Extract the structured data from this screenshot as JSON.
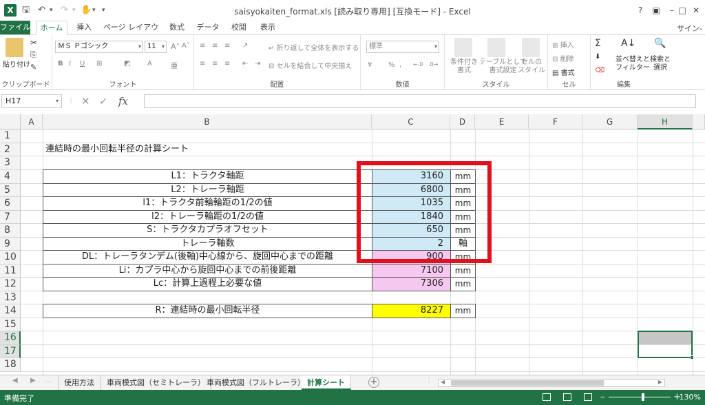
{
  "titlebar": {
    "title": "saisyokaiten_format.xls [読み取り専用] [互換モード] - Excel",
    "help": "?",
    "window_controls": [
      "restore-ribbon-icon",
      "minimize-icon",
      "maximize-icon",
      "close-icon"
    ]
  },
  "ribbon_tabs": {
    "file": "ファイル",
    "tabs": [
      "ホーム",
      "挿入",
      "ページ レイアウト",
      "数式",
      "データ",
      "校閲",
      "表示"
    ],
    "active": "ホーム",
    "signin": "サイン-"
  },
  "ribbon": {
    "clipboard": {
      "paste": "貼り付け",
      "label": "クリップボード"
    },
    "font": {
      "name": "ＭＳ Ｐゴシック",
      "size": "11",
      "label": "フォント",
      "bold": "B",
      "italic": "I",
      "underline": "U"
    },
    "alignment": {
      "wrap": "折り返して全体を表示する",
      "merge": "セルを結合して中央揃え",
      "label": "配置"
    },
    "number": {
      "format": "標準",
      "percent": "%",
      "comma": ",",
      "label": "数値"
    },
    "styles": {
      "conditional": [
        "条件付き",
        "書式"
      ],
      "table": [
        "テーブルとして",
        "書式設定"
      ],
      "cell": [
        "セルの",
        "スタイル"
      ],
      "label": "スタイル"
    },
    "cells": {
      "insert": "挿入",
      "delete": "削除",
      "format": "書式",
      "label": "セル"
    },
    "editing": {
      "sort": [
        "並べ替えと",
        "フィルター"
      ],
      "find": [
        "検索と",
        "選択"
      ],
      "label": "編集"
    }
  },
  "formula_bar": {
    "cell_ref": "H17",
    "fx": "fx",
    "content": ""
  },
  "columns": [
    "A",
    "B",
    "C",
    "D",
    "E",
    "F",
    "G",
    "H"
  ],
  "selected_column": "H",
  "rows": [
    "1",
    "2",
    "3",
    "4",
    "5",
    "6",
    "7",
    "8",
    "9",
    "10",
    "11",
    "12",
    "13",
    "14",
    "15",
    "16",
    "17",
    "18"
  ],
  "selected_rows": [
    "16",
    "17"
  ],
  "sheet": {
    "title": "連結時の最小回転半径の計算シート",
    "params": [
      {
        "label": "L1：トラクタ軸距",
        "value": "3160",
        "unit": "mm",
        "fill": "#cfe9f7"
      },
      {
        "label": "L2：トレーラ軸距",
        "value": "6800",
        "unit": "mm",
        "fill": "#cfe9f7"
      },
      {
        "label": "l1：トラクタ前輪輪距の1/2の値",
        "value": "1035",
        "unit": "mm",
        "fill": "#cfe9f7"
      },
      {
        "label": "l2：トレーラ輪距の1/2の値",
        "value": "1840",
        "unit": "mm",
        "fill": "#cfe9f7"
      },
      {
        "label": "S：トラクタカプラオフセット",
        "value": "650",
        "unit": "mm",
        "fill": "#cfe9f7"
      },
      {
        "label": "トレーラ軸数",
        "value": "2",
        "unit": "軸",
        "fill": "#cfe9f7"
      },
      {
        "label": "DL：トレーラタンデム(後軸)中心線から、旋回中心までの距離",
        "value": "900",
        "unit": "mm",
        "fill": "#f6c8f0"
      },
      {
        "label": "Li：カプラ中心から旋回中心までの前後距離",
        "value": "7100",
        "unit": "mm",
        "fill": "#f6c8f0"
      },
      {
        "label": "Lc：計算上過程上必要な値",
        "value": "7306",
        "unit": "mm",
        "fill": "#f6c8f0"
      }
    ],
    "result": {
      "label": "R：連結時の最小回転半径",
      "value": "8227",
      "unit": "mm",
      "fill": "#ffff00"
    }
  },
  "sheet_tabs": {
    "tabs": [
      "使用方法",
      "車両模式図（セミトレーラ）",
      "車両模式図（フルトレーラ）",
      "計算シート"
    ],
    "active": "計算シート",
    "add": "+"
  },
  "statusbar": {
    "status": "準備完了",
    "zoom": "130%",
    "zoom_level": 130
  },
  "colors": {
    "excel_green": "#217346",
    "highlight_red": "#e0101d"
  }
}
